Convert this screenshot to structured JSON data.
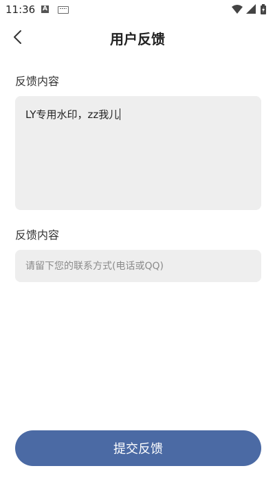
{
  "status_bar": {
    "time": "11:36",
    "app_indicator": "A",
    "icons": [
      "android-icon",
      "keyboard-icon",
      "wifi-icon",
      "signal-icon",
      "battery-charging-icon"
    ]
  },
  "header": {
    "title": "用户反馈",
    "back_icon": "chevron-left-icon"
  },
  "form": {
    "content_label": "反馈内容",
    "content_value": "LY专用水印，zz我儿",
    "contact_label": "反馈内容",
    "contact_value": "",
    "contact_placeholder": "请留下您的联系方式(电话或QQ)"
  },
  "submit": {
    "label": "提交反馈"
  },
  "colors": {
    "primary": "#4b6aa4",
    "field_background": "#eeeeee",
    "background": "#ffffff",
    "text": "#222222",
    "placeholder": "#8a8a8a"
  }
}
